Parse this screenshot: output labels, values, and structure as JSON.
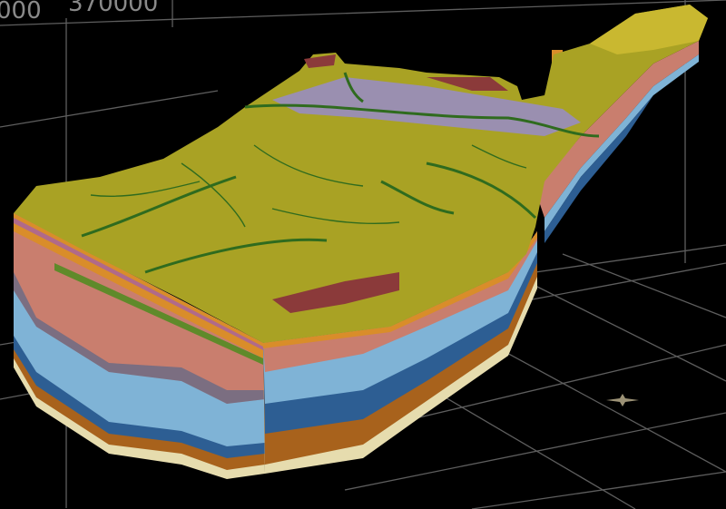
{
  "viewer": {
    "axis_labels": [
      "000",
      "370000"
    ],
    "colors": {
      "background": "#000000",
      "grid": "#6a6a6a",
      "surface": "#a9a224",
      "river": "#2f6b1e",
      "urban": "#9a8fb0",
      "clay": "#8b3a3a",
      "salmon_layer": "#c97e6e",
      "light_blue_layer": "#7fb3d6",
      "dark_blue_layer": "#2d5e93",
      "brown_layer": "#a8621c",
      "cream_layer": "#e6dcae",
      "orange_layer": "#d98d2a"
    },
    "north_arrow_icon": "compass-star"
  }
}
